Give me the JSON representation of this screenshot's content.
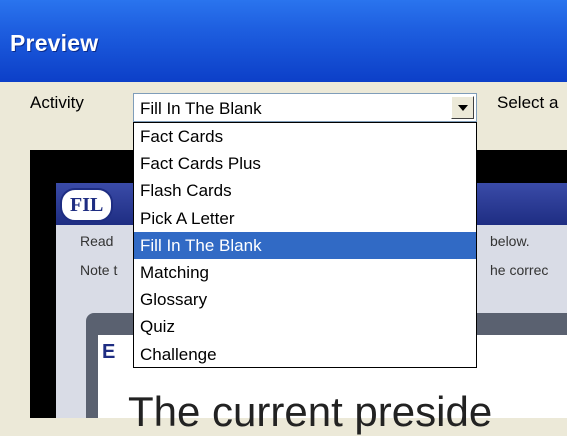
{
  "window": {
    "title": "Preview"
  },
  "toolbar": {
    "activity_label": "Activity",
    "activity_value": "Fill In The Blank",
    "select_label": "Select a"
  },
  "dropdown": {
    "selected_index": 4,
    "options": [
      "Fact Cards",
      "Fact Cards Plus",
      "Flash Cards",
      "Pick A Letter",
      "Fill In The Blank",
      "Matching",
      "Glossary",
      "Quiz",
      "Challenge"
    ]
  },
  "preview": {
    "logo_text": "FIL",
    "instruction_line1_left": "Read",
    "instruction_line1_right": "below.",
    "instruction_line2_left": "Note t",
    "instruction_line2_right": "he correc",
    "card_badge": "E",
    "question_text": "The current preside"
  },
  "colors": {
    "titlebar": "#1e5fe0",
    "selection": "#316ac5",
    "app_header": "#1e2d82"
  }
}
